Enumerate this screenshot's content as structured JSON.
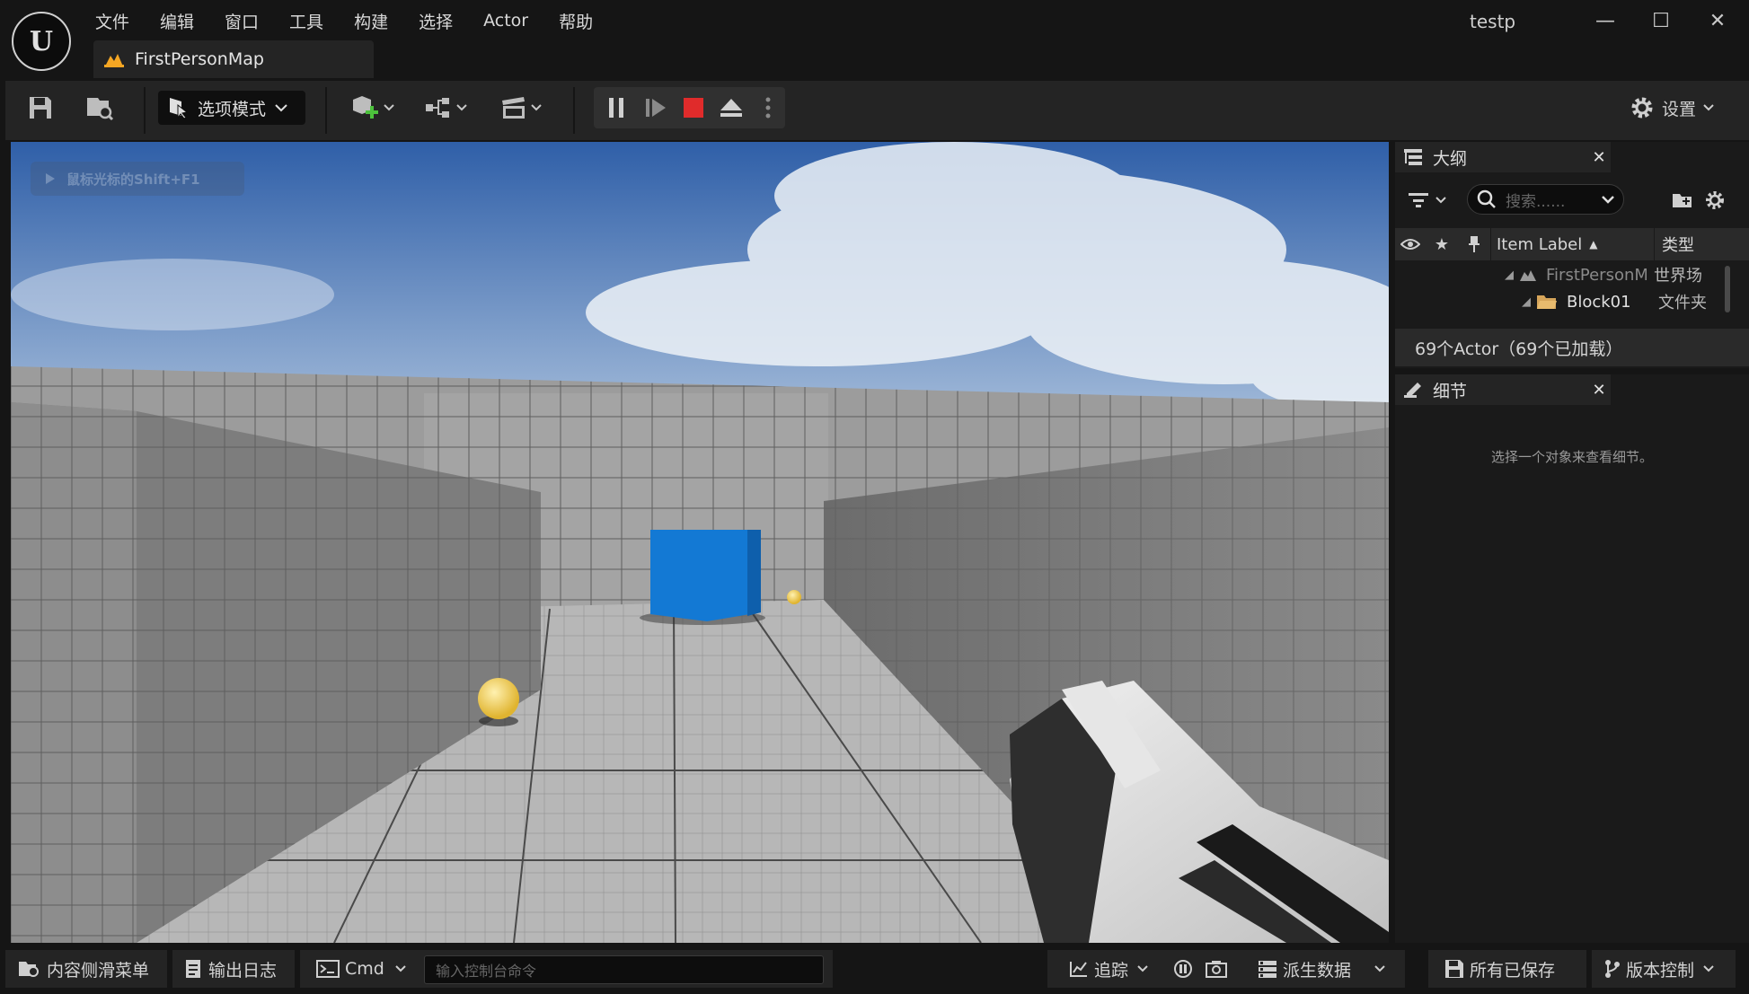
{
  "window": {
    "project_name": "testp",
    "minimize_glyph": "—",
    "maximize_glyph": "☐",
    "close_glyph": "✕"
  },
  "menu": [
    "文件",
    "编辑",
    "窗口",
    "工具",
    "构建",
    "选择",
    "Actor",
    "帮助"
  ],
  "level_tab": {
    "label": "FirstPersonMap"
  },
  "toolbar": {
    "mode_label": "选项模式",
    "settings_label": "设置"
  },
  "viewport": {
    "hint": "鼠标光标的Shift+F1"
  },
  "outliner": {
    "tab_title": "大纲",
    "search_placeholder": "搜索......",
    "col_label": "Item Label",
    "col_type": "类型",
    "rows": [
      {
        "label": "FirstPersonM",
        "type": "世界场"
      },
      {
        "label": "Block01",
        "type": "文件夹"
      }
    ],
    "actor_count": "69个Actor（69个已加载）"
  },
  "details": {
    "tab_title": "细节",
    "empty_message": "选择一个对象来查看细节。"
  },
  "statusbar": {
    "content_drawer": "内容侧滑菜单",
    "output_log": "输出日志",
    "cmd_label": "Cmd",
    "console_placeholder": "输入控制台命令",
    "trace_label": "追踪",
    "derived_data": "派生数据",
    "all_saved": "所有已保存",
    "source_control": "版本控制"
  },
  "colors": {
    "accent_orange": "#f5a623",
    "stop_red": "#e02b2b",
    "cube_blue": "#1379d4",
    "sphere_yellow": "#f3d36a"
  }
}
